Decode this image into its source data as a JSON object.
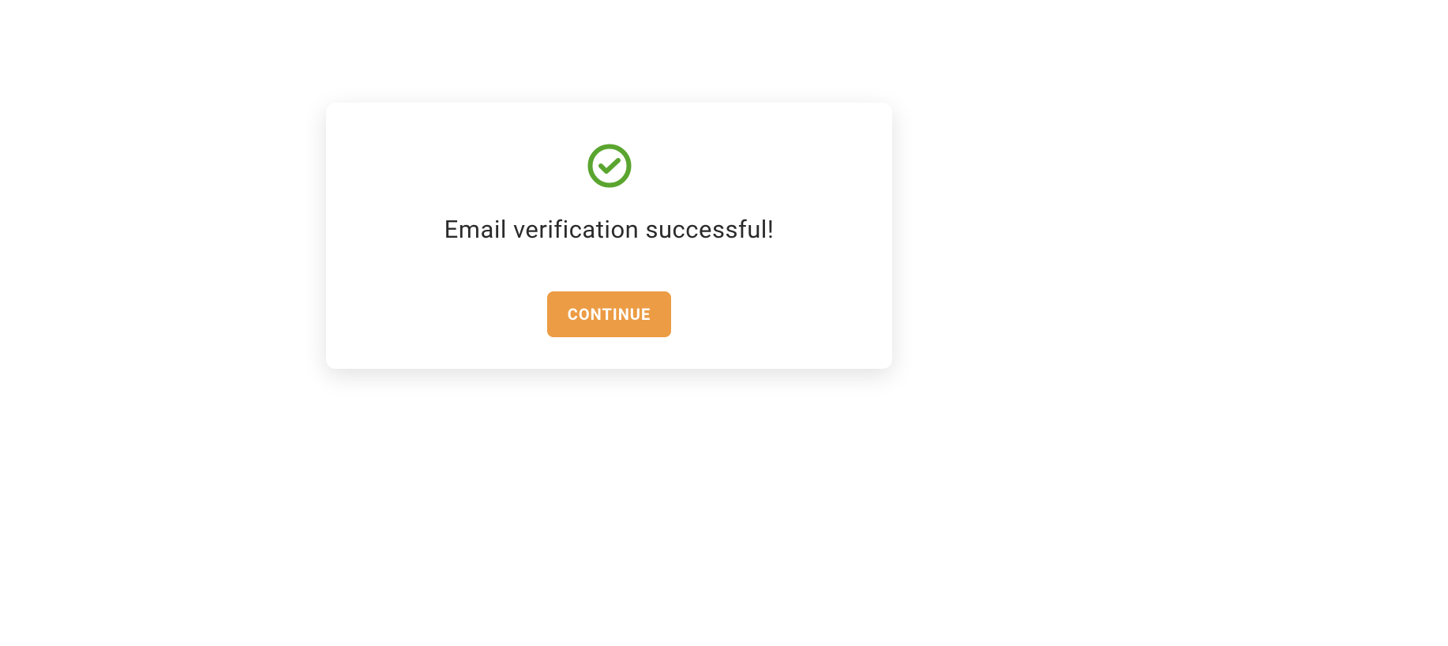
{
  "card": {
    "icon": "check-circle-icon",
    "heading": "Email verification successful!",
    "button_label": "CONTINUE"
  },
  "colors": {
    "icon_green": "#5aa52f",
    "button_orange": "#ec9c44"
  }
}
